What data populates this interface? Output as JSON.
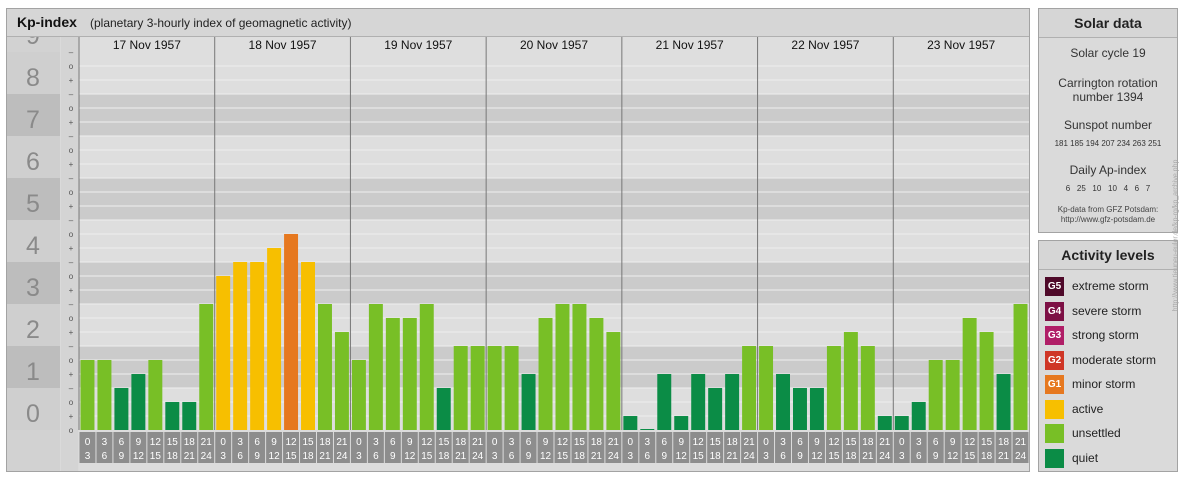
{
  "title": {
    "main": "Kp-index",
    "subtitle": "(planetary 3-hourly index of geomagnetic activity)"
  },
  "chart_data": {
    "type": "bar",
    "ylim": [
      0,
      9
    ],
    "y_ticks": [
      "0",
      "1",
      "2",
      "3",
      "4",
      "5",
      "6",
      "7",
      "8",
      "9"
    ],
    "sub_ticks": [
      "+",
      "o",
      "–"
    ],
    "days": [
      "17 Nov 1957",
      "18 Nov 1957",
      "19 Nov 1957",
      "20 Nov 1957",
      "21 Nov 1957",
      "22 Nov 1957",
      "23 Nov 1957"
    ],
    "interval_start": [
      "0",
      "3",
      "6",
      "9",
      "12",
      "15",
      "18",
      "21"
    ],
    "interval_end": [
      "3",
      "6",
      "9",
      "12",
      "15",
      "18",
      "21",
      "24"
    ],
    "values": [
      1.667,
      1.667,
      1.0,
      1.333,
      1.667,
      0.667,
      0.667,
      3.0,
      3.667,
      4.0,
      4.0,
      4.333,
      4.667,
      4.0,
      3.0,
      2.333,
      1.667,
      3.0,
      2.667,
      2.667,
      3.0,
      1.0,
      2.0,
      2.0,
      2.0,
      2.0,
      1.333,
      2.667,
      3.0,
      3.0,
      2.667,
      2.333,
      0.333,
      0.0,
      1.333,
      0.333,
      1.333,
      1.0,
      1.333,
      2.0,
      2.0,
      1.333,
      1.0,
      1.0,
      2.0,
      2.333,
      2.0,
      0.333,
      0.333,
      0.667,
      1.667,
      1.667,
      2.667,
      2.333,
      1.333,
      3.0
    ],
    "levels": [
      {
        "label": "quiet",
        "min": 0,
        "max": 1.5,
        "color": "#0b8c46"
      },
      {
        "label": "unsettled",
        "min": 1.5,
        "max": 3.5,
        "color": "#78bf26"
      },
      {
        "label": "active",
        "min": 3.5,
        "max": 4.5,
        "color": "#f7bf00"
      },
      {
        "label": "minor storm",
        "min": 4.5,
        "max": 5.5,
        "color": "#e6781f"
      }
    ]
  },
  "solar_data": {
    "header": "Solar data",
    "cycle": "Solar cycle 19",
    "carrington_1": "Carrington rotation",
    "carrington_2": "number 1394",
    "sunspot_title": "Sunspot number",
    "sunspot_values": "181 185 194 207 234 263 251",
    "ap_title": "Daily Ap-index",
    "ap_values": "6   25   10   10   4   6   7",
    "source_1": "Kp-data from  GFZ Potsdam:",
    "source_2": "http://www.gfz-potsdam.de"
  },
  "activity_levels": {
    "header": "Activity levels",
    "items": [
      {
        "badge": "G5",
        "label": "extreme storm",
        "color": "#4f0a2a"
      },
      {
        "badge": "G4",
        "label": "severe storm",
        "color": "#7d1045"
      },
      {
        "badge": "G3",
        "label": "strong storm",
        "color": "#b01e67"
      },
      {
        "badge": "G2",
        "label": "moderate storm",
        "color": "#cf3626"
      },
      {
        "badge": "G1",
        "label": "minor storm",
        "color": "#e6781f"
      },
      {
        "badge": "",
        "label": "active",
        "color": "#f7bf00"
      },
      {
        "badge": "",
        "label": "unsettled",
        "color": "#78bf26"
      },
      {
        "badge": "",
        "label": "quiet",
        "color": "#0b8c46"
      }
    ]
  },
  "watermark": "http://www.tieuneu-euler.de/kp-rg/kp_archive.php"
}
